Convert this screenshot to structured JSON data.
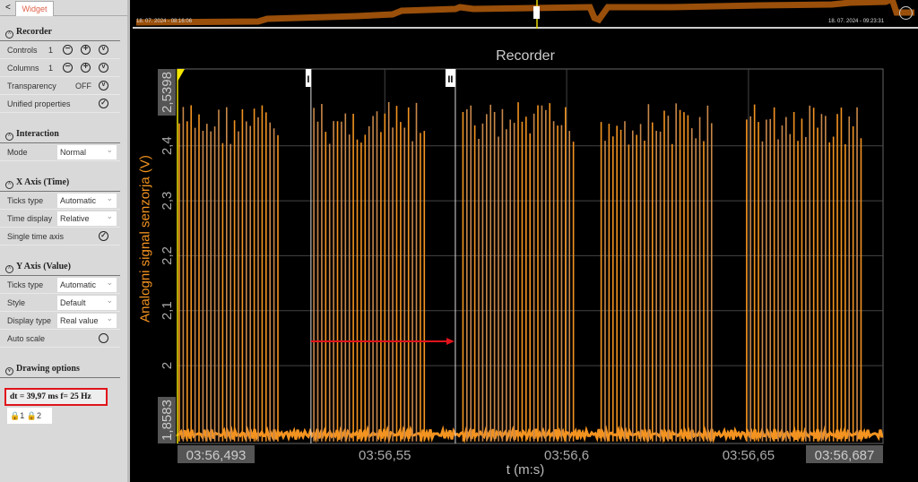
{
  "sidebar": {
    "back": "<",
    "tab": "Widget",
    "recorder": {
      "title": "Recorder",
      "controls_label": "Controls",
      "controls_value": "1",
      "columns_label": "Columns",
      "columns_value": "1",
      "transparency_label": "Transparency",
      "transparency_value": "OFF",
      "unified_label": "Unified properties"
    },
    "interaction": {
      "title": "Interaction",
      "mode_label": "Mode",
      "mode_value": "Normal"
    },
    "xaxis": {
      "title": "X Axis (Time)",
      "ticks_label": "Ticks type",
      "ticks_value": "Automatic",
      "time_display_label": "Time display",
      "time_display_value": "Relative",
      "single_label": "Single time axis"
    },
    "yaxis": {
      "title": "Y Axis (Value)",
      "ticks_label": "Ticks type",
      "ticks_value": "Automatic",
      "style_label": "Style",
      "style_value": "Default",
      "display_label": "Display type",
      "display_value": "Real value",
      "auto_label": "Auto scale"
    },
    "drawing": {
      "title": "Drawing options"
    },
    "measure": "dt = 39,97 ms  f= 25 Hz",
    "lock1": "1",
    "lock2": "2"
  },
  "overview": {
    "start": "18. 07. 2024 - 08:16:06",
    "end": "18. 07. 2024 - 09:23:31"
  },
  "chart_data": {
    "type": "line",
    "title": "Recorder",
    "xlabel": "t (m:s)",
    "ylabel": "Analogni signal senzorja (V)",
    "xlim_s": [
      56.493,
      56.687
    ],
    "ylim": [
      1.8583,
      2.5398
    ],
    "x_ticks": [
      {
        "v": 56.55,
        "label": "03:56,55"
      },
      {
        "v": 56.6,
        "label": "03:56,6"
      },
      {
        "v": 56.65,
        "label": "03:56,65"
      }
    ],
    "x_edge_labels": [
      "03:56,493",
      "03:56,687"
    ],
    "y_ticks": [
      {
        "v": 2.0,
        "label": "2"
      },
      {
        "v": 2.1,
        "label": "2,1"
      },
      {
        "v": 2.2,
        "label": "2,2"
      },
      {
        "v": 2.3,
        "label": "2,3"
      },
      {
        "v": 2.4,
        "label": "2,4"
      }
    ],
    "y_edge_labels": [
      "1,8583",
      "2,5398"
    ],
    "baseline": 1.875,
    "peak": 2.5,
    "bursts_s": [
      [
        56.493,
        56.521
      ],
      [
        56.53,
        56.561
      ],
      [
        56.571,
        56.602
      ],
      [
        56.609,
        56.64
      ],
      [
        56.649,
        56.681
      ]
    ],
    "cursors": [
      {
        "label": "I",
        "t": 56.5297
      },
      {
        "label": "II",
        "t": 56.5694
      }
    ],
    "series_color": "#f39320"
  }
}
